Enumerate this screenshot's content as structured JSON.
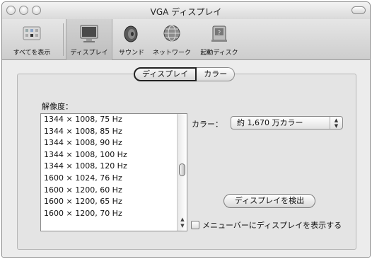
{
  "window": {
    "title": "VGA ディスプレイ"
  },
  "toolbar": {
    "items": [
      {
        "label": "すべてを表示",
        "icon": "grid-icon"
      },
      {
        "label": "ディスプレイ",
        "icon": "display-icon"
      },
      {
        "label": "サウンド",
        "icon": "speaker-icon"
      },
      {
        "label": "ネットワーク",
        "icon": "network-globe-icon"
      },
      {
        "label": "起動ディスク",
        "icon": "startup-disk-icon"
      }
    ]
  },
  "tabs": [
    {
      "label": "ディスプレイ",
      "selected": true
    },
    {
      "label": "カラー",
      "selected": false
    }
  ],
  "resolution": {
    "label": "解像度：",
    "items": [
      "1344 × 1008, 75 Hz",
      "1344 × 1008, 85 Hz",
      "1344 × 1008, 90 Hz",
      "1344 × 1008, 100 Hz",
      "1344 × 1008, 120 Hz",
      "1600 × 1024, 76 Hz",
      "1600 × 1200, 60 Hz",
      "1600 × 1200, 65 Hz",
      "1600 × 1200, 70 Hz"
    ]
  },
  "colors": {
    "label": "カラー：",
    "selected": "約 1,670 万カラー"
  },
  "detect_button": "ディスプレイを検出",
  "show_in_menubar": {
    "label": "メニューバーにディスプレイを表示する",
    "checked": false
  }
}
